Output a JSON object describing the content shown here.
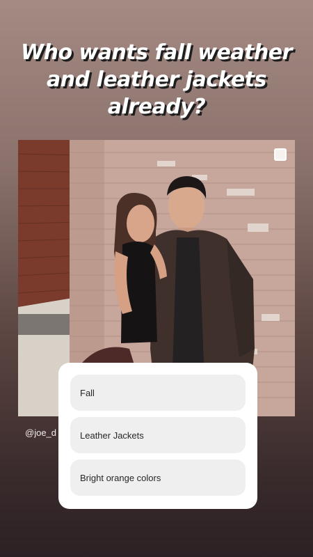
{
  "story": {
    "title": "Who wants fall weather and leather jackets already?",
    "credit": "@joe_d"
  },
  "poll": {
    "options": [
      "Fall",
      "Leather Jackets",
      "Bright orange colors"
    ]
  },
  "icons": {
    "multi_photo": "multi-photo-icon"
  }
}
